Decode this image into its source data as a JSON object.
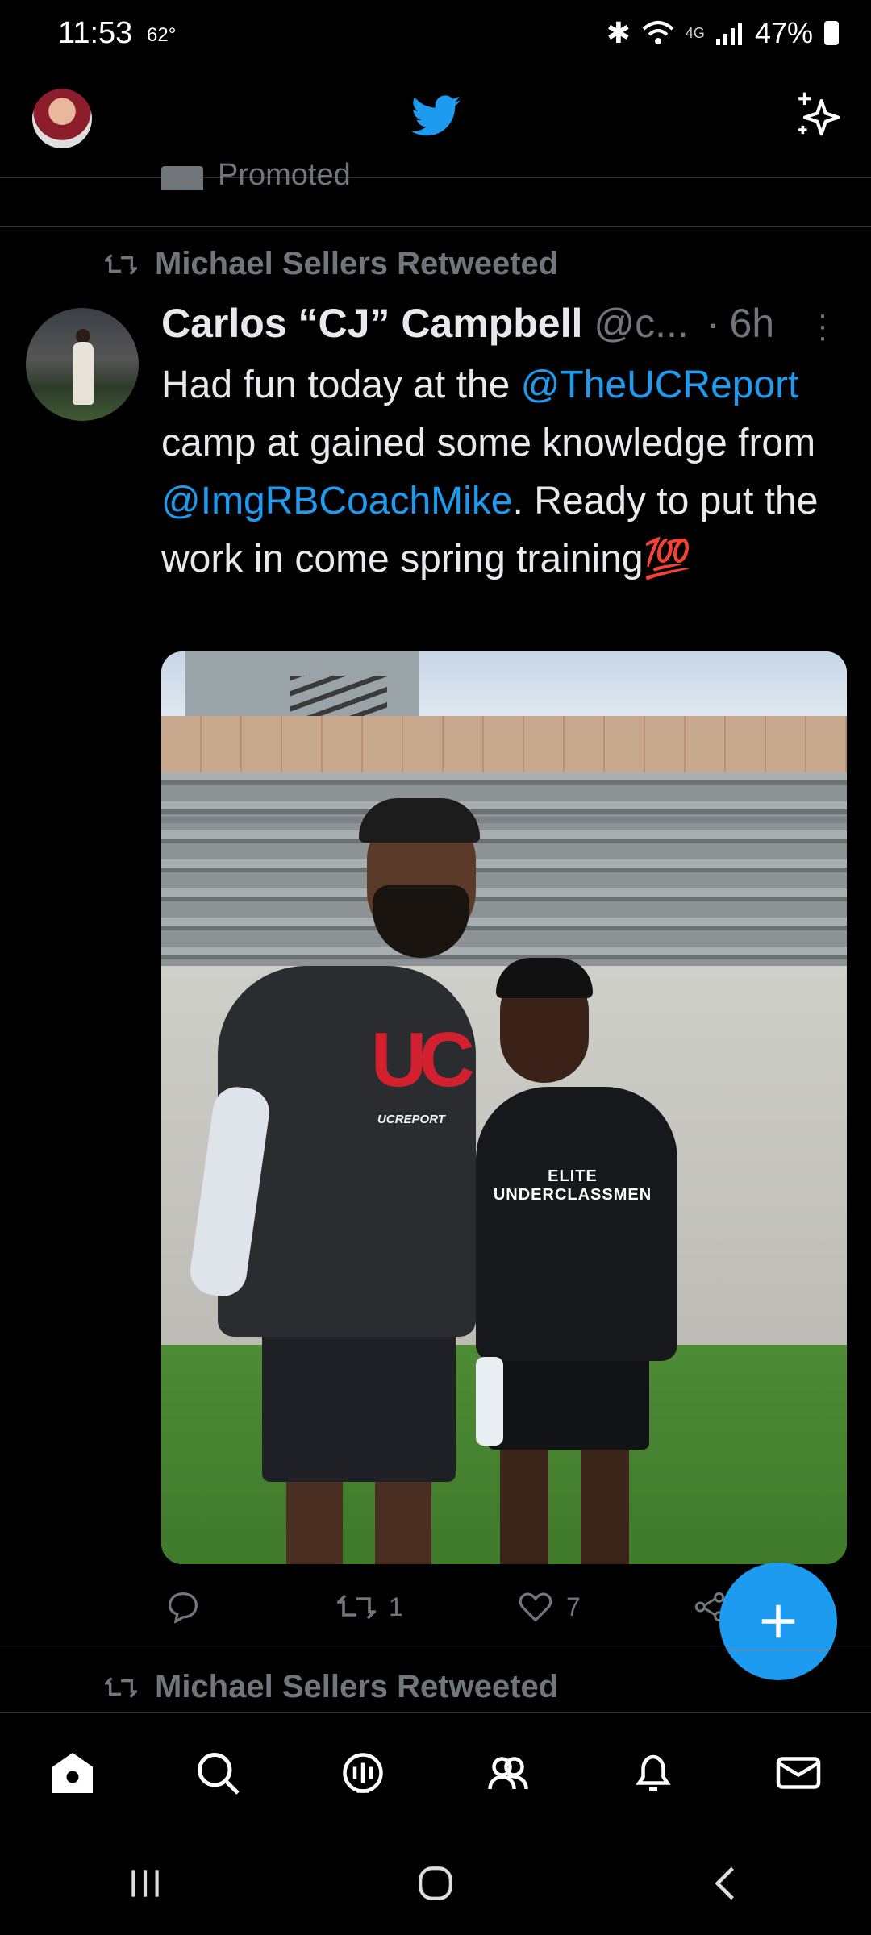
{
  "status_bar": {
    "time": "11:53",
    "temperature": "62°",
    "network": "4G",
    "battery": "47%"
  },
  "header": {
    "logo_icon": "twitter-bird-icon",
    "sparkle_icon": "sparkle-icon"
  },
  "promoted": {
    "label": "Promoted"
  },
  "tweet": {
    "retweeted_by": "Michael Sellers Retweeted",
    "author_name": "Carlos “CJ” Campbell",
    "author_handle": "@c...",
    "separator": "·",
    "time": "6h",
    "text_parts": {
      "p1": "Had fun today at the ",
      "m1": "@TheUCReport",
      "p2": " camp at gained some knowledge from ",
      "m2": "@ImgRBCoachMike",
      "p3": ". Ready to put the work in come spring training",
      "emoji": "💯"
    },
    "photo": {
      "coach_shirt_logo": "UC",
      "coach_shirt_text": "UCREPORT",
      "kid_shirt_line1": "ELITE",
      "kid_shirt_line2": "UNDERCLASSMEN"
    },
    "actions": {
      "reply_count": "",
      "retweet_count": "1",
      "like_count": "7"
    }
  },
  "next_tweet": {
    "retweeted_by": "Michael Sellers Retweeted"
  },
  "colors": {
    "accent": "#1d9bf0",
    "muted": "#71767b",
    "background": "#000000"
  },
  "bottom_nav": [
    {
      "name": "home",
      "icon": "home-icon"
    },
    {
      "name": "search",
      "icon": "search-icon"
    },
    {
      "name": "spaces",
      "icon": "spaces-icon"
    },
    {
      "name": "communities",
      "icon": "communities-icon"
    },
    {
      "name": "notifications",
      "icon": "bell-icon"
    },
    {
      "name": "messages",
      "icon": "envelope-icon"
    }
  ]
}
